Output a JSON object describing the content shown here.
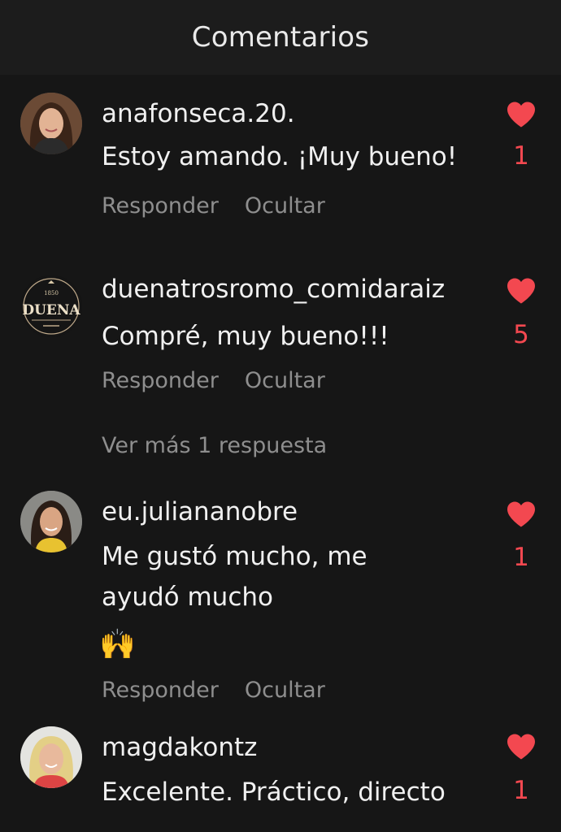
{
  "header": {
    "title": "Comentarios"
  },
  "colors": {
    "background": "#161616",
    "header": "#1c1c1c",
    "text": "#f0f0f0",
    "muted": "#8e8e8e",
    "like": "#f34850"
  },
  "comments": [
    {
      "username": "anafonseca.20.",
      "lines": [
        "Estoy amando. ¡Muy bueno!"
      ],
      "likes": "1",
      "reply_label": "Responder",
      "hide_label": "Ocultar",
      "liked_icon": "heart-filled-icon"
    },
    {
      "username": "duenatrosromo_comidaraiz",
      "lines": [
        "Compré, muy bueno!!!"
      ],
      "likes": "5",
      "reply_label": "Responder",
      "hide_label": "Ocultar",
      "liked_icon": "heart-filled-icon",
      "avatar_logo": {
        "year": "1850",
        "name": "DUENA"
      },
      "more_replies": "Ver más 1 respuesta"
    },
    {
      "username": "eu.juliananobre",
      "lines": [
        "Me gustó mucho, me",
        "ayudó mucho"
      ],
      "emoji": "🙌",
      "likes": "1",
      "reply_label": "Responder",
      "hide_label": "Ocultar",
      "liked_icon": "heart-filled-icon"
    },
    {
      "username": "magdakontz",
      "lines": [
        "Excelente. Práctico, directo"
      ],
      "likes": "1",
      "liked_icon": "heart-filled-icon"
    }
  ]
}
